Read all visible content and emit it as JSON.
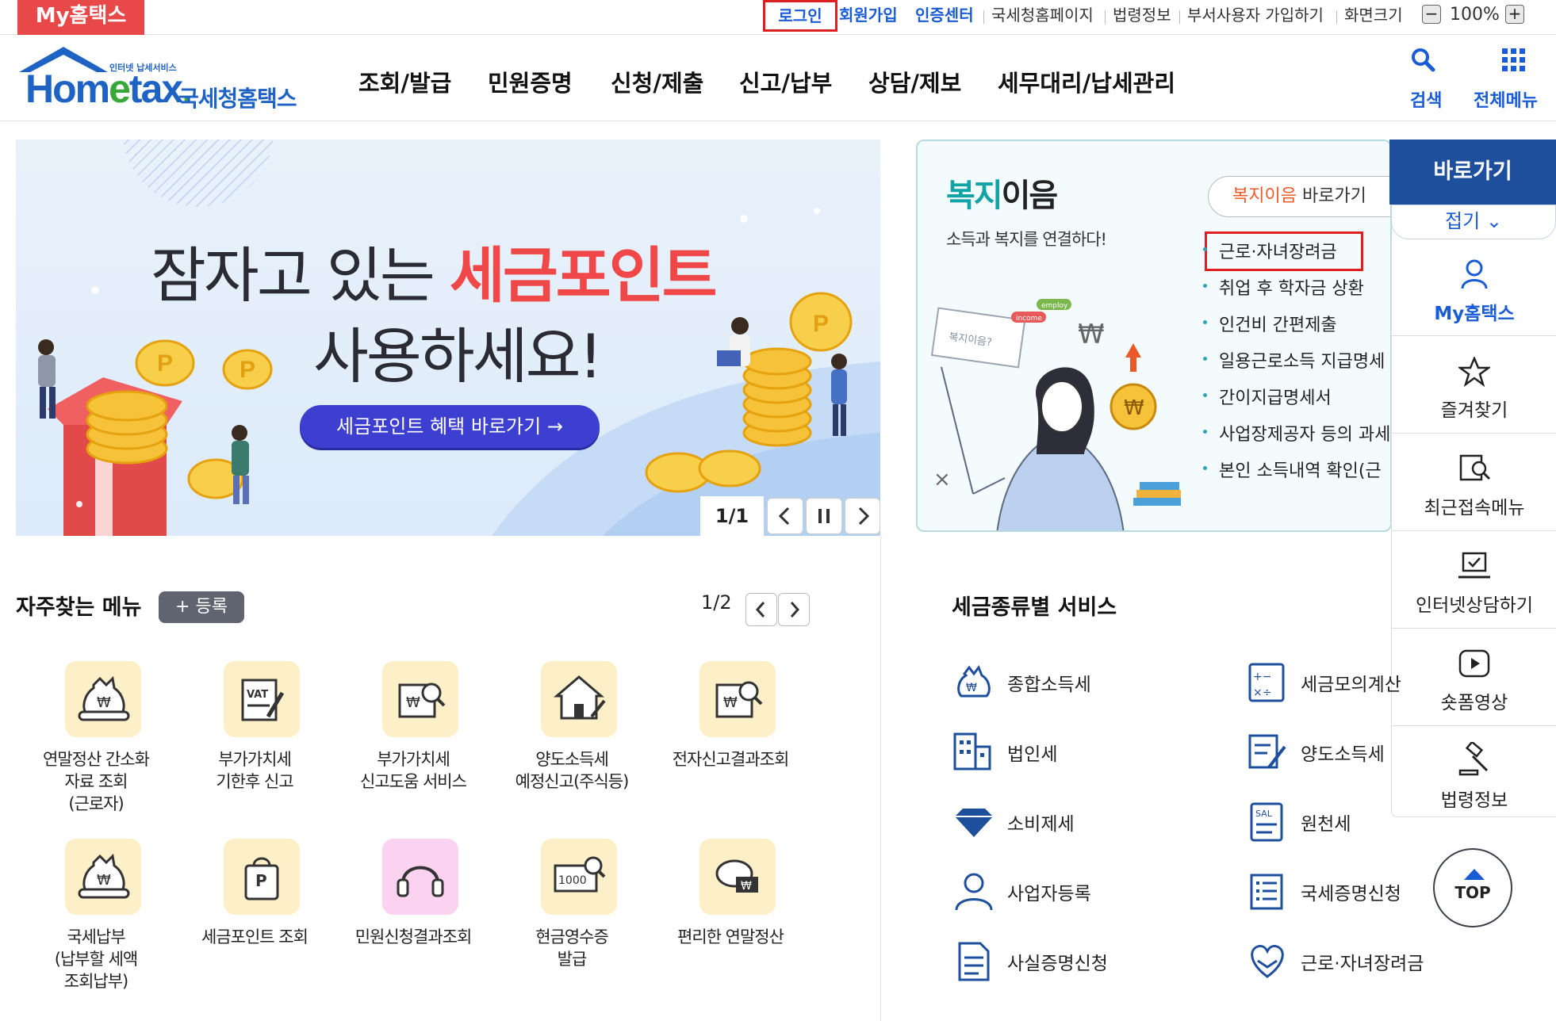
{
  "topbar": {
    "myhometax": "My홈택스",
    "login": "로그인",
    "signup": "회원가입",
    "cert": "인증센터",
    "links": [
      "국세청홈페이지",
      "법령정보",
      "부서사용자 가입하기",
      "화면크기"
    ],
    "zoom_minus": "−",
    "zoom_value": "100%",
    "zoom_plus": "+"
  },
  "header": {
    "logo_small": "인터넷 납세서비스",
    "logo_main_a": "Hom",
    "logo_main_e": "e",
    "logo_main_b": "tax",
    "logo_dot": ".",
    "logo_kr": "국세청홈택스",
    "nav": [
      "조회/발급",
      "민원증명",
      "신청/제출",
      "신고/납부",
      "상담/제보",
      "세무대리/납세관리"
    ],
    "search_label": "검색",
    "allmenu_label": "전체메뉴"
  },
  "banner": {
    "line1_a": "잠자고 있는 ",
    "line1_b": "세금포인트",
    "line2": "사용하세요!",
    "cta": "세금포인트 혜택 바로가기 →",
    "page_indicator": "1/1",
    "coin_letter": "P",
    "colors": {
      "accent": "#f04848",
      "cta": "#3d3fd1"
    }
  },
  "welfare": {
    "title_a": "복지",
    "title_b": "이음",
    "subtitle": "소득과 복지를 연결하다!",
    "goto_a": "복지이음",
    "goto_b": " 바로가기",
    "sign_text": "복지이음?",
    "tag1": "income",
    "tag2": "employ",
    "items": [
      "근로·자녀장려금",
      "취업 후 학자금 상환",
      "인건비 간편제출",
      "일용근로소득 지급명세",
      "간이지급명세서",
      "사업장제공자 등의 과세",
      "본인 소득내역 확인(근"
    ]
  },
  "quick": {
    "title": "바로가기",
    "fold": "접기 ⌄",
    "items": [
      "My홈택스",
      "즐겨찾기",
      "최근접속메뉴",
      "인터넷상담하기",
      "숏폼영상",
      "법령정보"
    ],
    "top": "TOP"
  },
  "favorites": {
    "title": "자주찾는 메뉴",
    "register": "+ 등록",
    "page": "1/2",
    "items": [
      {
        "label": [
          "연말정산 간소화",
          "자료 조회",
          "(근로자)"
        ],
        "icon": "money-bag-icon"
      },
      {
        "label": [
          "부가가치세",
          "기한후 신고"
        ],
        "icon": "vat-document-icon"
      },
      {
        "label": [
          "부가가치세",
          "신고도움 서비스"
        ],
        "icon": "won-search-icon"
      },
      {
        "label": [
          "양도소득세",
          "예정신고(주식등)"
        ],
        "icon": "house-pen-icon"
      },
      {
        "label": [
          "전자신고결과조회"
        ],
        "icon": "won-magnify-icon"
      },
      {
        "label": [
          "국세납부",
          "(납부할 세액",
          "조회납부)"
        ],
        "icon": "money-bag-icon"
      },
      {
        "label": [
          "세금포인트 조회"
        ],
        "icon": "point-bag-icon"
      },
      {
        "label": [
          "민원신청결과조회"
        ],
        "icon": "headset-icon"
      },
      {
        "label": [
          "현금영수증",
          "발급"
        ],
        "icon": "receipt-icon"
      },
      {
        "label": [
          "편리한 연말정산"
        ],
        "icon": "chat-won-icon"
      }
    ],
    "vat_text": "VAT",
    "receipt_text": "1000"
  },
  "taxservices": {
    "title": "세금종류별 서비스",
    "items": [
      "종합소득세",
      "세금모의계산",
      "법인세",
      "양도소득세",
      "소비제세",
      "원천세",
      "사업자등록",
      "국세증명신청",
      "사실증명신청",
      "근로·자녀장려금"
    ],
    "sal_text": "SAL"
  }
}
